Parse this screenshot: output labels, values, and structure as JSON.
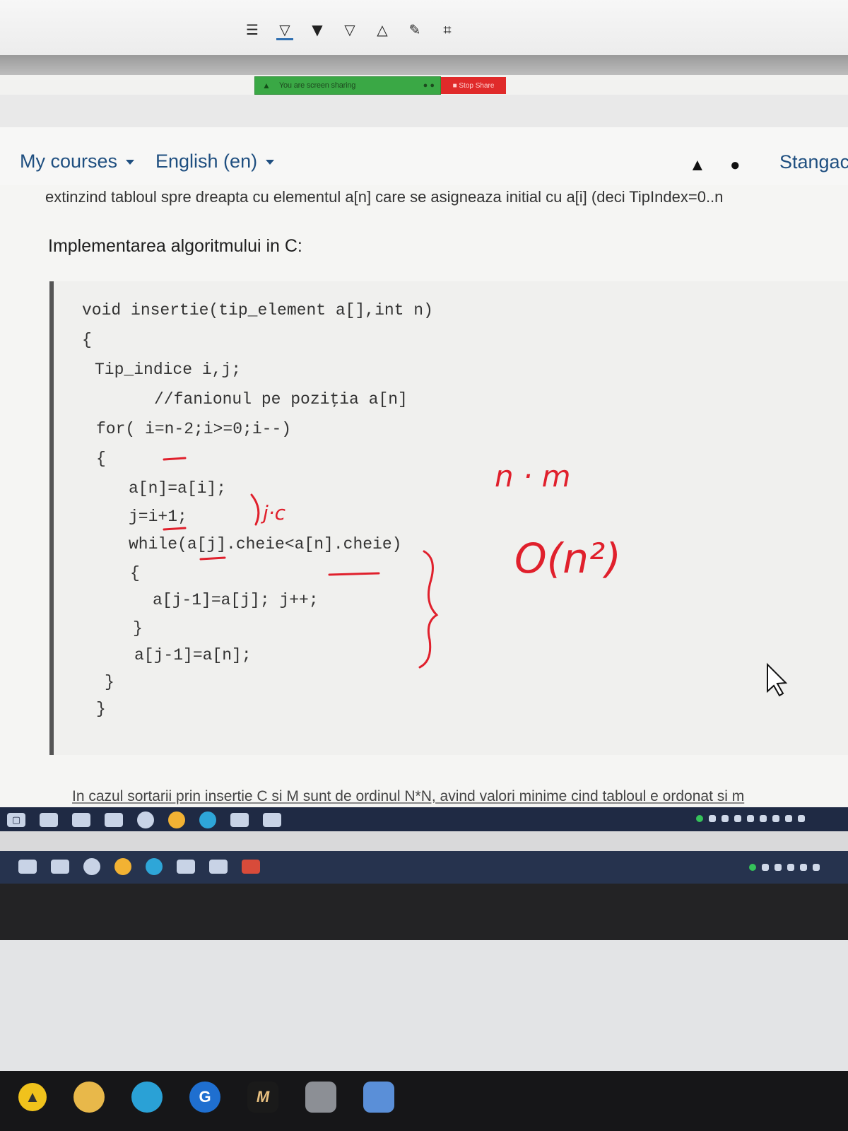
{
  "annotation_toolbar": {
    "tools": [
      {
        "name": "mouse-icon",
        "glyph": "☰"
      },
      {
        "name": "text-marker-icon",
        "glyph": "▽"
      },
      {
        "name": "draw-icon",
        "glyph": "▼"
      },
      {
        "name": "stamp-icon",
        "glyph": "▽"
      },
      {
        "name": "spotlight-icon",
        "glyph": "△"
      },
      {
        "name": "eraser-icon",
        "glyph": "✎"
      },
      {
        "name": "crop-icon",
        "glyph": "⌗"
      }
    ]
  },
  "share_bar": {
    "status_text": "You are screen sharing",
    "stop_label": "Stop Share"
  },
  "nav": {
    "my_courses": "My courses",
    "language": "English (en)",
    "user_name": "Stangaci"
  },
  "content": {
    "cut_line": "extinzind tabloul spre dreapta cu elementul a[n] care se asigneaza initial cu a[i] (deci TipIndex=0..n",
    "section_title": "Implementarea algoritmului in C:",
    "code_lines": [
      "void insertie(tip_element a[],int n)",
      "{",
      "Tip_indice i,j;",
      "//fanionul pe poziţia a[n]",
      "for( i=n-2;i>=0;i--)",
      "{",
      "a[n]=a[i];",
      "j=i+1;",
      "while(a[j].cheie<a[n].cheie)",
      "{",
      "a[j-1]=a[j]; j++;",
      "}",
      "a[j-1]=a[n];",
      "}",
      "}"
    ],
    "bottom_text": "In cazul sortarii prin insertie C si M sunt de ordinul N*N, avind valori minime cind tabloul e ordonat si m"
  },
  "handwriting": {
    "n_m": "n · m",
    "complexity": "O(n²)",
    "j_c": "j·c",
    "color": "#e0202c"
  },
  "colors": {
    "link": "#1f4f80",
    "share_green": "#3aa845",
    "stop_red": "#e02a2a",
    "taskbar": "#1f2a44"
  }
}
